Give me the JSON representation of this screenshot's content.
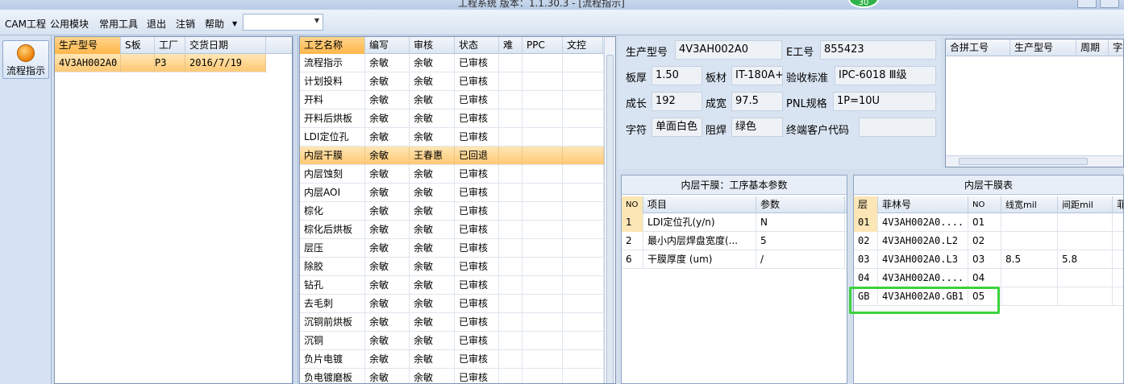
{
  "window": {
    "title": "工程系统   版本：1.1.30.3 - [流程指示]",
    "badge": "30"
  },
  "menu": {
    "items": [
      "CAM工程",
      "公用模块",
      "常用工具",
      "退出",
      "注销",
      "帮助"
    ],
    "dropdown_value": ""
  },
  "nav": {
    "button_label": "流程指示"
  },
  "orders": {
    "columns": [
      "生产型号",
      "S板",
      "工厂",
      "交货日期"
    ],
    "rows": [
      {
        "model": "4V3AH002A0",
        "s": "",
        "factory": "P3",
        "date": "2016/7/19"
      }
    ]
  },
  "process": {
    "columns": [
      "工艺名称",
      "编写",
      "审核",
      "状态",
      "难",
      "PPC",
      "文控"
    ],
    "rows": [
      [
        "流程指示",
        "余敏",
        "余敏",
        "已审核"
      ],
      [
        "计划投料",
        "余敏",
        "余敏",
        "已审核"
      ],
      [
        "开料",
        "余敏",
        "余敏",
        "已审核"
      ],
      [
        "开料后烘板",
        "余敏",
        "余敏",
        "已审核"
      ],
      [
        "LDI定位孔",
        "余敏",
        "余敏",
        "已审核"
      ],
      [
        "内层干膜",
        "余敏",
        "王春惠",
        "已回退"
      ],
      [
        "内层蚀刻",
        "余敏",
        "余敏",
        "已审核"
      ],
      [
        "内层AOI",
        "余敏",
        "余敏",
        "已审核"
      ],
      [
        "棕化",
        "余敏",
        "余敏",
        "已审核"
      ],
      [
        "棕化后烘板",
        "余敏",
        "余敏",
        "已审核"
      ],
      [
        "层压",
        "余敏",
        "余敏",
        "已审核"
      ],
      [
        "除胶",
        "余敏",
        "余敏",
        "已审核"
      ],
      [
        "钻孔",
        "余敏",
        "余敏",
        "已审核"
      ],
      [
        "去毛刺",
        "余敏",
        "余敏",
        "已审核"
      ],
      [
        "沉铜前烘板",
        "余敏",
        "余敏",
        "已审核"
      ],
      [
        "沉铜",
        "余敏",
        "余敏",
        "已审核"
      ],
      [
        "负片电镀",
        "余敏",
        "余敏",
        "已审核"
      ],
      [
        "负电镀磨板",
        "余敏",
        "余敏",
        "已审核"
      ]
    ]
  },
  "info": {
    "model_label": "生产型号",
    "model": "4V3AH002A0",
    "eno_label": "E工号",
    "eno": "855423",
    "thickness_label": "板厚",
    "thickness": "1.50",
    "material_label": "板材",
    "material": "IT-180A+",
    "standard_label": "验收标准",
    "standard": "IPC-6018 Ⅲ级",
    "length_label": "成长",
    "length": "192",
    "width_label": "成宽",
    "width": "97.5",
    "pnl_label": "PNL规格",
    "pnl": "1P=10U",
    "char_label": "字符",
    "char": "单面白色",
    "mask_label": "阻焊",
    "mask": "绿色",
    "customer_label": "终端客户代码",
    "customer": ""
  },
  "merge": {
    "columns": [
      "合拼工号",
      "生产型号",
      "周期",
      "字符"
    ]
  },
  "params": {
    "title": "内层干膜：工序基本参数",
    "columns": [
      "NO",
      "项目",
      "参数"
    ],
    "rows": [
      [
        "1",
        "LDI定位孔(y/n)",
        "N"
      ],
      [
        "2",
        "最小内层焊盘宽度(...",
        "5"
      ],
      [
        "6",
        "干膜厚度 (um)",
        "/"
      ]
    ]
  },
  "films": {
    "title": "内层干膜表",
    "columns": [
      "层",
      "菲林号",
      "NO",
      "线宽mil",
      "间距mil",
      "菲"
    ],
    "rows": [
      [
        "01",
        "4V3AH002A0....",
        "01",
        "",
        ""
      ],
      [
        "02",
        "4V3AH002A0.L2",
        "02",
        "",
        ""
      ],
      [
        "03",
        "4V3AH002A0.L3",
        "03",
        "8.5",
        "5.8"
      ],
      [
        "04",
        "4V3AH002A0....",
        "04",
        "",
        ""
      ],
      [
        "GB",
        "4V3AH002A0.GB1",
        "05",
        "",
        ""
      ]
    ]
  }
}
